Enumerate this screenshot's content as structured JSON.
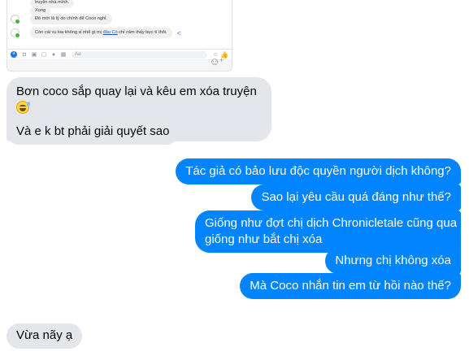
{
  "embedded_screenshot": {
    "messages": [
      {
        "text": "truyện nhà mình.",
        "has_avatar": false
      },
      {
        "text": "Xong",
        "has_avatar": false
      },
      {
        "text": "Đó mới là lý do chính để Coco nghỉ.",
        "has_avatar": true
      },
      {
        "text_before": "Còn cái vụ kia không sỉ nhẽ gì mị ",
        "text_link": "đâu Có",
        "text_after": " chỉ cảm thấy bực tí thôi.",
        "has_avatar": true
      }
    ],
    "composer_placeholder": "Aa",
    "icons": [
      "plus-icon",
      "camera-icon",
      "image-icon",
      "sticker-icon",
      "microphone-icon",
      "gif-icon",
      "emoji-icon",
      "like-icon",
      "share-icon"
    ]
  },
  "conversation": {
    "incoming": [
      {
        "line1": "Bơn coco sắp quay lại và kêu em xóa truyện",
        "emoji_count_line1": 1,
        "emoji_count_line2": 1
      },
      {
        "text": "Và e k bt phải giải quyết sao"
      },
      {
        "text": "Vừa nãy ạ"
      }
    ],
    "outgoing": [
      {
        "text": "Tác giả có bảo lưu độc quyền người dịch không?"
      },
      {
        "text": "Sao lại yêu cầu quá đáng như thế?"
      },
      {
        "line1": "Giống như đợt chị dịch Chronicletale cũng qua",
        "line2": "giống như bắt chị xóa"
      },
      {
        "text": "Nhưng chị không xóa"
      },
      {
        "text": "Mà Coco nhắn tin em từ hồi nào thế?"
      }
    ]
  },
  "colors": {
    "outgoing_bubble": "#0084ff",
    "incoming_bubble": "#e4e6eb"
  }
}
